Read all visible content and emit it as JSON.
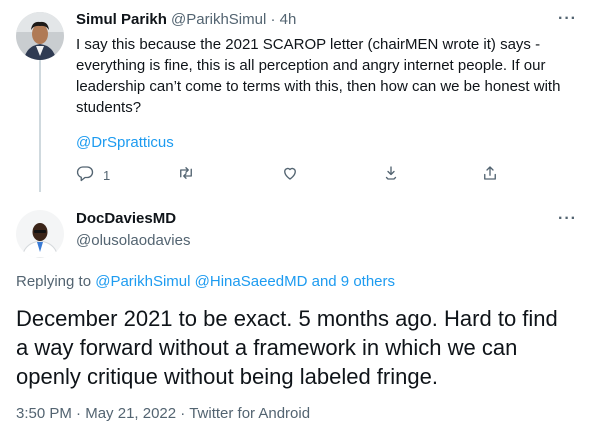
{
  "tweet1": {
    "name": "Simul Parikh",
    "handle": "@ParikhSimul",
    "separator": " · ",
    "time": "4h",
    "text": "I say this because the 2021 SCAROP letter (chairMEN wrote it) says - everything is fine, this is all perception and angry internet people. If our leadership can’t come to terms with this, then how can we be honest with students?",
    "mention": "@DrSpratticus",
    "reply_count": "1",
    "more": "···",
    "icons": [
      "reply-icon",
      "retweet-icon",
      "like-icon",
      "download-icon",
      "share-icon"
    ]
  },
  "tweet2": {
    "name": "DocDaviesMD",
    "handle": "@olusolaodavies",
    "more": "···",
    "replying_prefix": "Replying to ",
    "replying_user1": "@ParikhSimul",
    "replying_user2": "@HinaSaeedMD",
    "replying_others": "and 9 others",
    "text": "December 2021 to be exact. 5 months ago. Hard to find a way forward without a framework in which we can openly critique without being labeled fringe.",
    "time": "3:50 PM",
    "date": "May 21, 2022",
    "source": "Twitter for Android",
    "meta_sep": " · "
  },
  "colors": {
    "text": "#0f1419",
    "muted": "#536471",
    "link": "#1d9bf0",
    "line": "#cfd9de"
  }
}
